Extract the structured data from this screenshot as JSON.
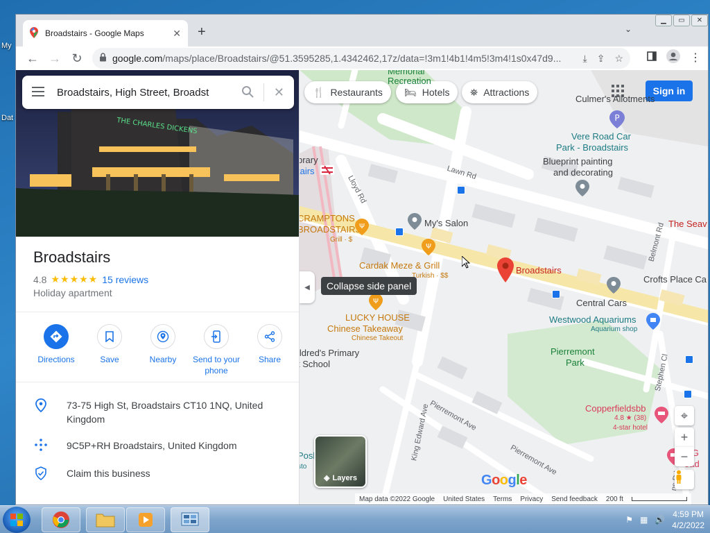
{
  "desktop": {
    "icon_labels": [
      "My",
      "Dat"
    ]
  },
  "browser": {
    "tab_title": "Broadstairs - Google Maps",
    "url_host": "google.com",
    "url_rest": "/maps/place/Broadstairs/@51.3595285,1.4342462,17z/data=!3m1!4b1!4m5!3m4!1s0x47d9..."
  },
  "search": {
    "value": "Broadstairs, High Street, Broadst"
  },
  "place": {
    "name": "Broadstairs",
    "rating": "4.8",
    "stars": "★★★★★",
    "reviews": "15 reviews",
    "category": "Holiday apartment",
    "photo_sign": "THE CHARLES DICKENS"
  },
  "actions": [
    {
      "label": "Directions",
      "icon": "directions-icon"
    },
    {
      "label": "Save",
      "icon": "bookmark-icon"
    },
    {
      "label": "Nearby",
      "icon": "nearby-icon"
    },
    {
      "label": "Send to your phone",
      "icon": "send-to-phone-icon"
    },
    {
      "label": "Share",
      "icon": "share-icon"
    }
  ],
  "info": {
    "address": "73-75 High St, Broadstairs CT10 1NQ, United Kingdom",
    "plus_code": "9C5P+RH Broadstairs, United Kingdom",
    "claim": "Claim this business"
  },
  "map": {
    "chips": [
      "Restaurants",
      "Hotels",
      "Attractions"
    ],
    "sign_in": "Sign in",
    "tooltip": "Collapse side panel",
    "layers": "Layers",
    "pin_label": "Broadstairs",
    "labels": {
      "memorial": "Memorial",
      "recreation": "Recreation",
      "culmers": "Culmer's Allotments",
      "vere_road": "Vere Road Car",
      "vere_road2": "Park - Broadstairs",
      "blueprint": "Blueprint painting",
      "blueprint2": "and decorating",
      "library": "brary",
      "stairs": "tairs",
      "cramptons": "CRAMPTONS",
      "cramptons2": "BROADSTAIRS",
      "cramptons3": "Grill · $",
      "mys_salon": "My's Salon",
      "cardak": "Cardak Meze & Grill",
      "cardak2": "Turkish · $$",
      "the_sea": "The Seav",
      "crofts": "Crofts Place Ca",
      "central_cars": "Central Cars",
      "westwood": "Westwood Aquariums",
      "westwood2": "Aquarium shop",
      "lucky": "LUCKY HOUSE",
      "lucky2": "Chinese Takeaway",
      "lucky3": "Chinese Takeout",
      "school": "ildred's Primary",
      "school2": "t School",
      "pierremont": "Pierremont",
      "pierremont2": "Park",
      "copperfields": "Copperfieldsbb",
      "copperfields2": "4.8 ★ (38)",
      "copperfields3": "4-star hotel",
      "posl": "Posl",
      "sto": "sto",
      "ge": "e G",
      "oad": "oad",
      "belmont": "Belmont Rd",
      "stephen": "Stephen Cl",
      "lawn": "Lawn Rd",
      "lloyd": "Lloyd Rd",
      "pierremont_ave": "Pierremont Ave",
      "pierremont_ave2": "Pierremont Ave",
      "king_edward": "King Edward Ave",
      "ns_rd": "ns Rd"
    },
    "footer": {
      "map_data": "Map data ©2022 Google",
      "country": "United States",
      "terms": "Terms",
      "privacy": "Privacy",
      "feedback": "Send feedback",
      "scale": "200 ft"
    },
    "google_letters": [
      "G",
      "o",
      "o",
      "g",
      "l",
      "e"
    ],
    "google_colors": [
      "#4285f4",
      "#ea4335",
      "#fbbc05",
      "#4285f4",
      "#34a853",
      "#ea4335"
    ]
  },
  "taskbar": {
    "time": "4:59 PM",
    "date": "4/2/2022"
  },
  "colors": {
    "accent": "#1a73e8",
    "pin": "#ea4335"
  }
}
